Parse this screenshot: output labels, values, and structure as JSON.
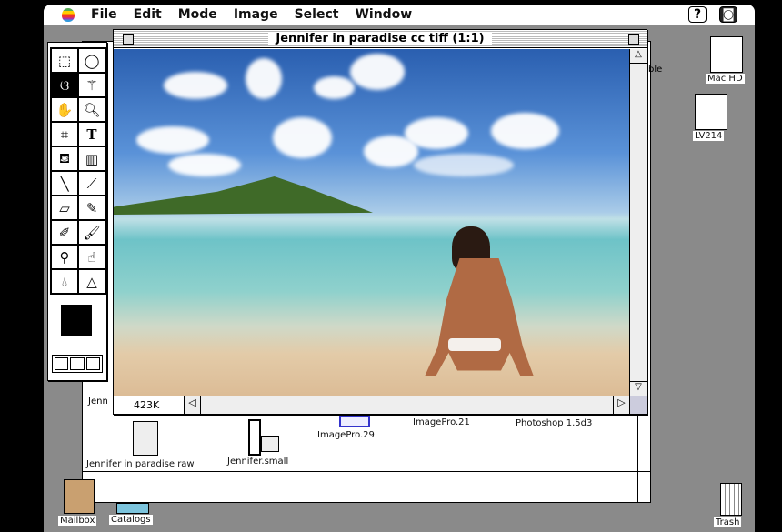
{
  "menubar": {
    "items": [
      "File",
      "Edit",
      "Mode",
      "Image",
      "Select",
      "Window"
    ],
    "help_icon": "balloon-help-icon",
    "app_icon": "photoshop-app-icon"
  },
  "image_window": {
    "title": "Jennifer in paradise cc tiff  (1:1)",
    "size_label": "423K"
  },
  "finder": {
    "partial_label": "Jenn",
    "partial_right": "ble",
    "files": [
      {
        "name": "Jennifer in paradise raw",
        "icon": "document-icon"
      },
      {
        "name": "Jennifer.small",
        "icon": "film-document-icon"
      },
      {
        "name": "ImagePro.29",
        "icon": "application-icon"
      },
      {
        "name": "ImagePro.21",
        "icon": "application-icon"
      },
      {
        "name": "Photoshop 1.5d3",
        "icon": "application-icon"
      }
    ]
  },
  "desktop": {
    "disks": [
      "Mac HD",
      "LV214"
    ],
    "mailbox": "Mailbox",
    "catalogs": "Catalogs",
    "trash": "Trash"
  },
  "toolbox": {
    "tools": [
      "rect-marquee",
      "ellipse-marquee",
      "lasso",
      "magic-wand",
      "hand",
      "zoom",
      "crop",
      "type",
      "paint-bucket",
      "gradient",
      "line",
      "eyedropper",
      "eraser",
      "pencil",
      "airbrush",
      "paintbrush",
      "rubber-stamp",
      "smudge",
      "blur",
      "sharpen"
    ],
    "selected": "lasso",
    "foreground_color": "#000000"
  }
}
